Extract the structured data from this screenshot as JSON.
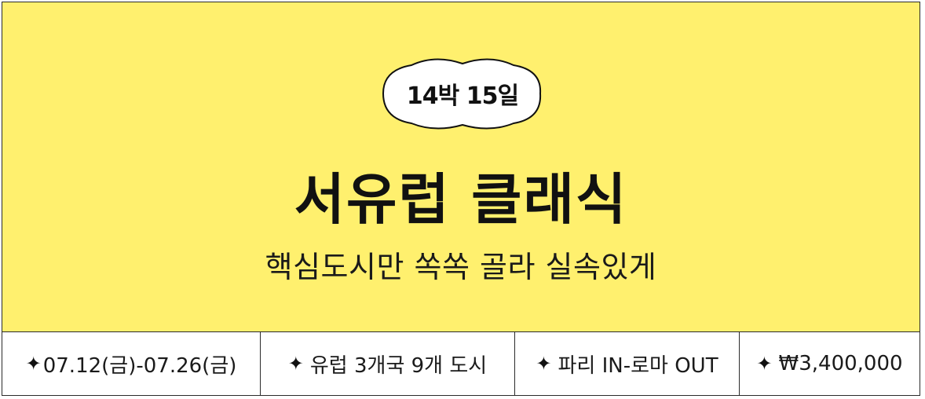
{
  "colors": {
    "hero_background": "#fff06e",
    "border": "#2b2b2b",
    "text": "#111111"
  },
  "badge": {
    "label": "14박 15일",
    "shape": "cloud"
  },
  "hero": {
    "title": "서유럽 클래식",
    "subtitle": "핵심도시만 쏙쏙 골라 실속있게"
  },
  "info_bar": {
    "bullet_icon": "four-point-star-icon",
    "bullet_glyph": "✦",
    "items": [
      {
        "label": "07.12(금)-07.26(금)"
      },
      {
        "label": "유럽 3개국 9개 도시"
      },
      {
        "label": "파리 IN-로마 OUT"
      },
      {
        "label": "₩3,400,000"
      }
    ]
  }
}
